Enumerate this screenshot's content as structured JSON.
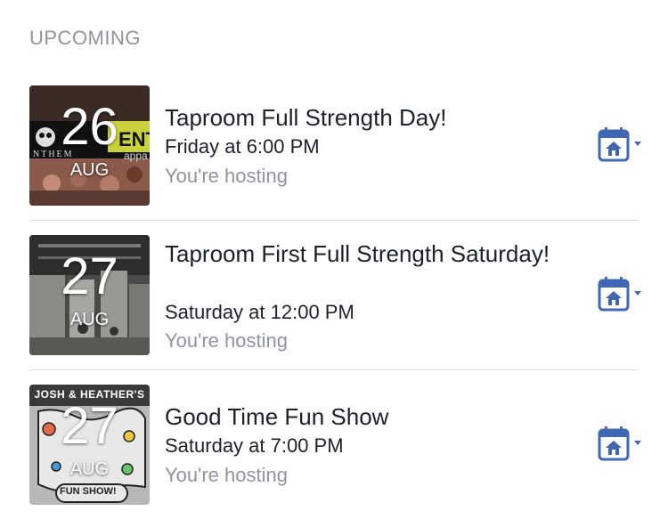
{
  "section": {
    "title": "UPCOMING"
  },
  "events": [
    {
      "day": "26",
      "month": "AUG",
      "title": "Taproom Full Strength Day!",
      "time": "Friday at 6:00 PM",
      "status": "You're hosting",
      "thumb_overlay_text": "ENT",
      "thumb_sub_text": "NTHEM",
      "thumb_sub_text2": "appa"
    },
    {
      "day": "27",
      "month": "AUG",
      "title": "Taproom First Full Strength Saturday!",
      "time": "Saturday at 12:00 PM",
      "status": "You're hosting"
    },
    {
      "day": "27",
      "month": "AUG",
      "title": "Good Time Fun Show",
      "time": "Saturday at 7:00 PM",
      "status": "You're hosting",
      "thumb_overlay_text": "JOSH & HEATHER'S",
      "thumb_sub_text": "FUN SHOW!"
    }
  ],
  "icons": {
    "calendar": "calendar-home-icon",
    "dropdown": "caret-down-icon"
  },
  "colors": {
    "accent": "#4267b2",
    "muted_text": "#90949c",
    "primary_text": "#1d2129",
    "divider": "#dddfe2"
  }
}
